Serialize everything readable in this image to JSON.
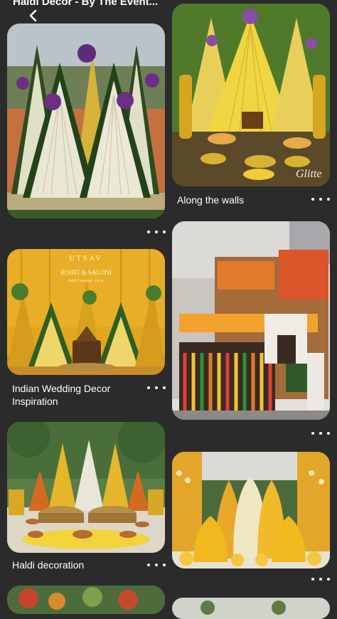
{
  "header": {
    "title": "Haldi Decor - By The Event..."
  },
  "pins": [
    {
      "id": "haldi-triangles-green",
      "title": ""
    },
    {
      "id": "haldi-yellow-walls",
      "title": "Along the walls"
    },
    {
      "id": "utsav-stage",
      "title": "Indian Wedding Decor Inspiration",
      "sign_lines": [
        "UTSAV",
        "ROHIT & SALONI",
        "Haldi Ceremony · Decor"
      ]
    },
    {
      "id": "house-decor",
      "title": ""
    },
    {
      "id": "haldi-urli",
      "title": "Haldi decoration"
    },
    {
      "id": "marigold-leaves",
      "title": ""
    }
  ],
  "watermark": "Glitte"
}
